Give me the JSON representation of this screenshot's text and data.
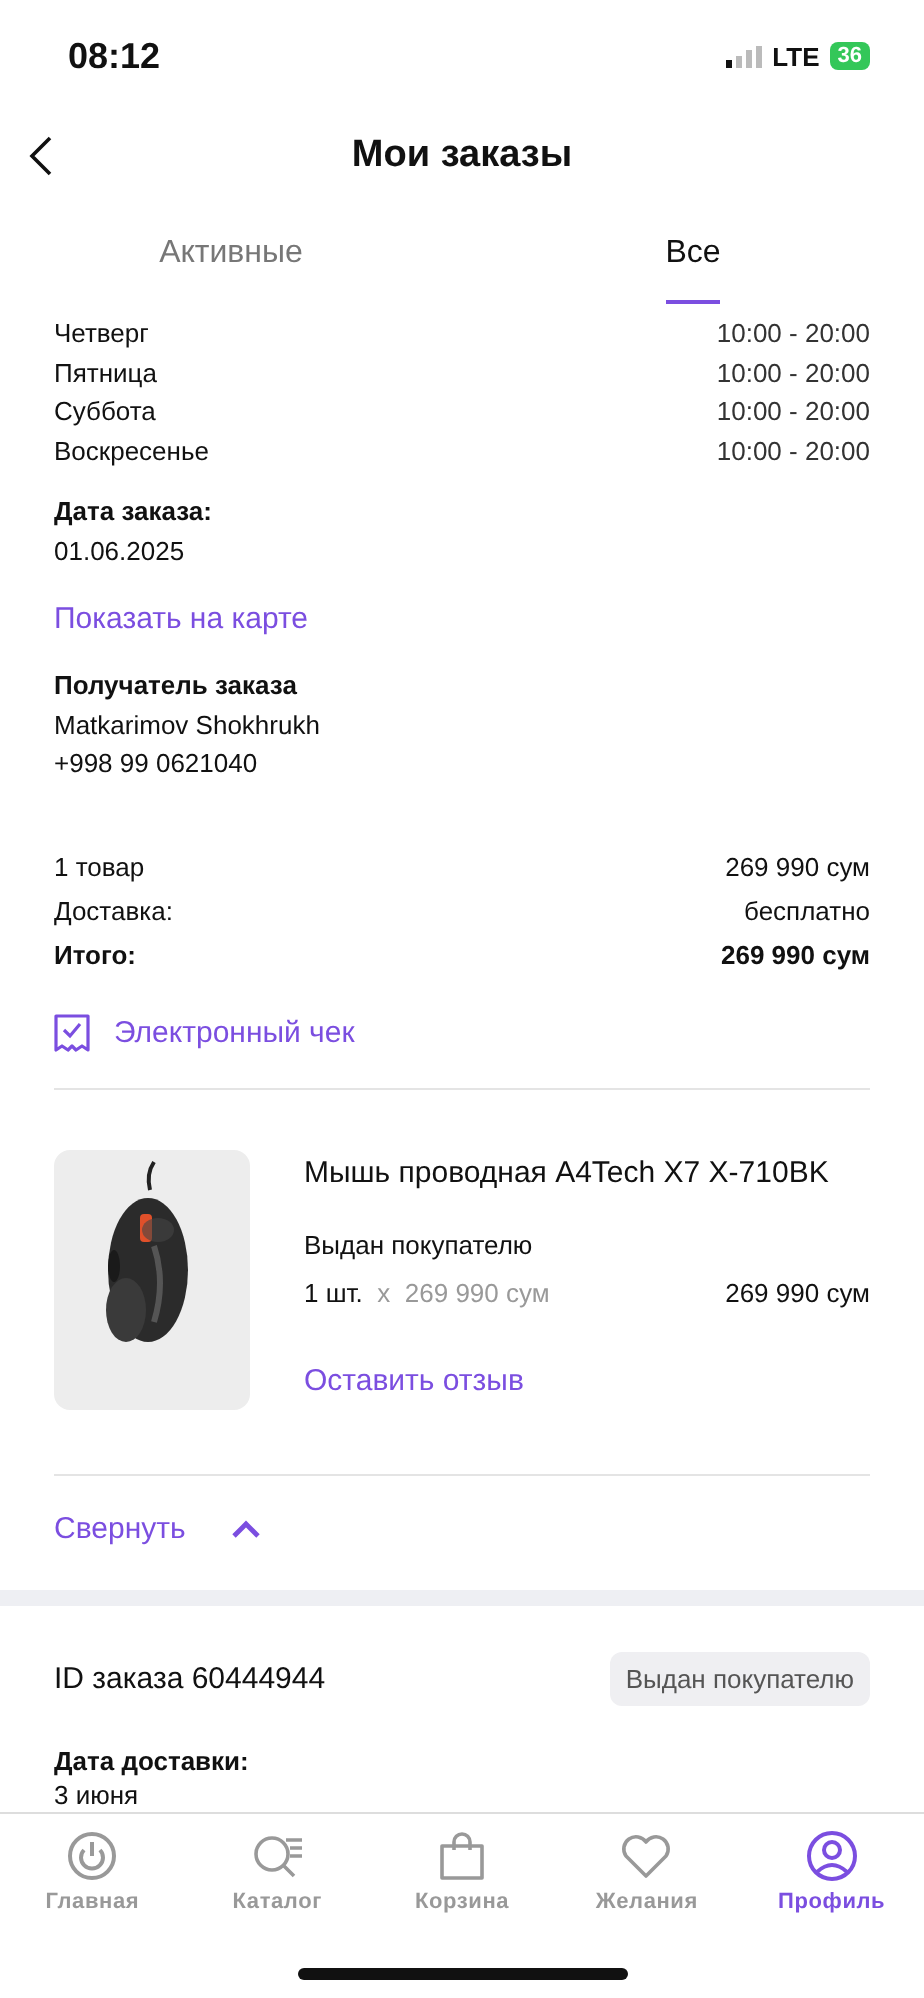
{
  "status_bar": {
    "time": "08:12",
    "network": "LTE",
    "battery": "36"
  },
  "header": {
    "title": "Мои заказы"
  },
  "tabs": [
    {
      "label": "Активные",
      "selected": false
    },
    {
      "label": "Все",
      "selected": true
    }
  ],
  "schedule": [
    {
      "day": "Четверг",
      "hours": "10:00 - 20:00"
    },
    {
      "day": "Пятница",
      "hours": "10:00 - 20:00"
    },
    {
      "day": "Суббота",
      "hours": "10:00 - 20:00"
    },
    {
      "day": "Воскресенье",
      "hours": "10:00 - 20:00"
    }
  ],
  "order_date": {
    "label": "Дата заказа:",
    "value": "01.06.2025"
  },
  "map_link": "Показать на карте",
  "recipient": {
    "label": "Получатель заказа",
    "name": "Matkarimov Shokhrukh",
    "phone": "+998 99 0621040"
  },
  "summary": [
    {
      "label": "1 товар",
      "value": "269 990 сум",
      "bold": false
    },
    {
      "label": "Доставка:",
      "value": "бесплатно",
      "bold": false
    },
    {
      "label": "Итого:",
      "value": "269 990 сум",
      "bold": true
    }
  ],
  "receipt_link": "Электронный чек",
  "product": {
    "name": "Мышь проводная A4Tech X7 X-710BK",
    "status": "Выдан покупателю",
    "quantity": "1 шт.",
    "times": "x",
    "unit_price": "269 990 сум",
    "total": "269 990 сум",
    "review_link": "Оставить отзыв"
  },
  "collapse": {
    "label": "Свернуть",
    "expanded": true
  },
  "next_order": {
    "id": "ID заказа 60444944",
    "status": "Выдан покупателю",
    "date_label": "Дата доставки:",
    "date": "3 июня"
  },
  "nav": [
    {
      "label": "Главная",
      "kind": "home",
      "selected": false
    },
    {
      "label": "Каталог",
      "kind": "catalog",
      "selected": false
    },
    {
      "label": "Корзина",
      "kind": "cart",
      "selected": false
    },
    {
      "label": "Желания",
      "kind": "wishlist",
      "selected": false
    },
    {
      "label": "Профиль",
      "kind": "profile",
      "selected": true
    }
  ]
}
